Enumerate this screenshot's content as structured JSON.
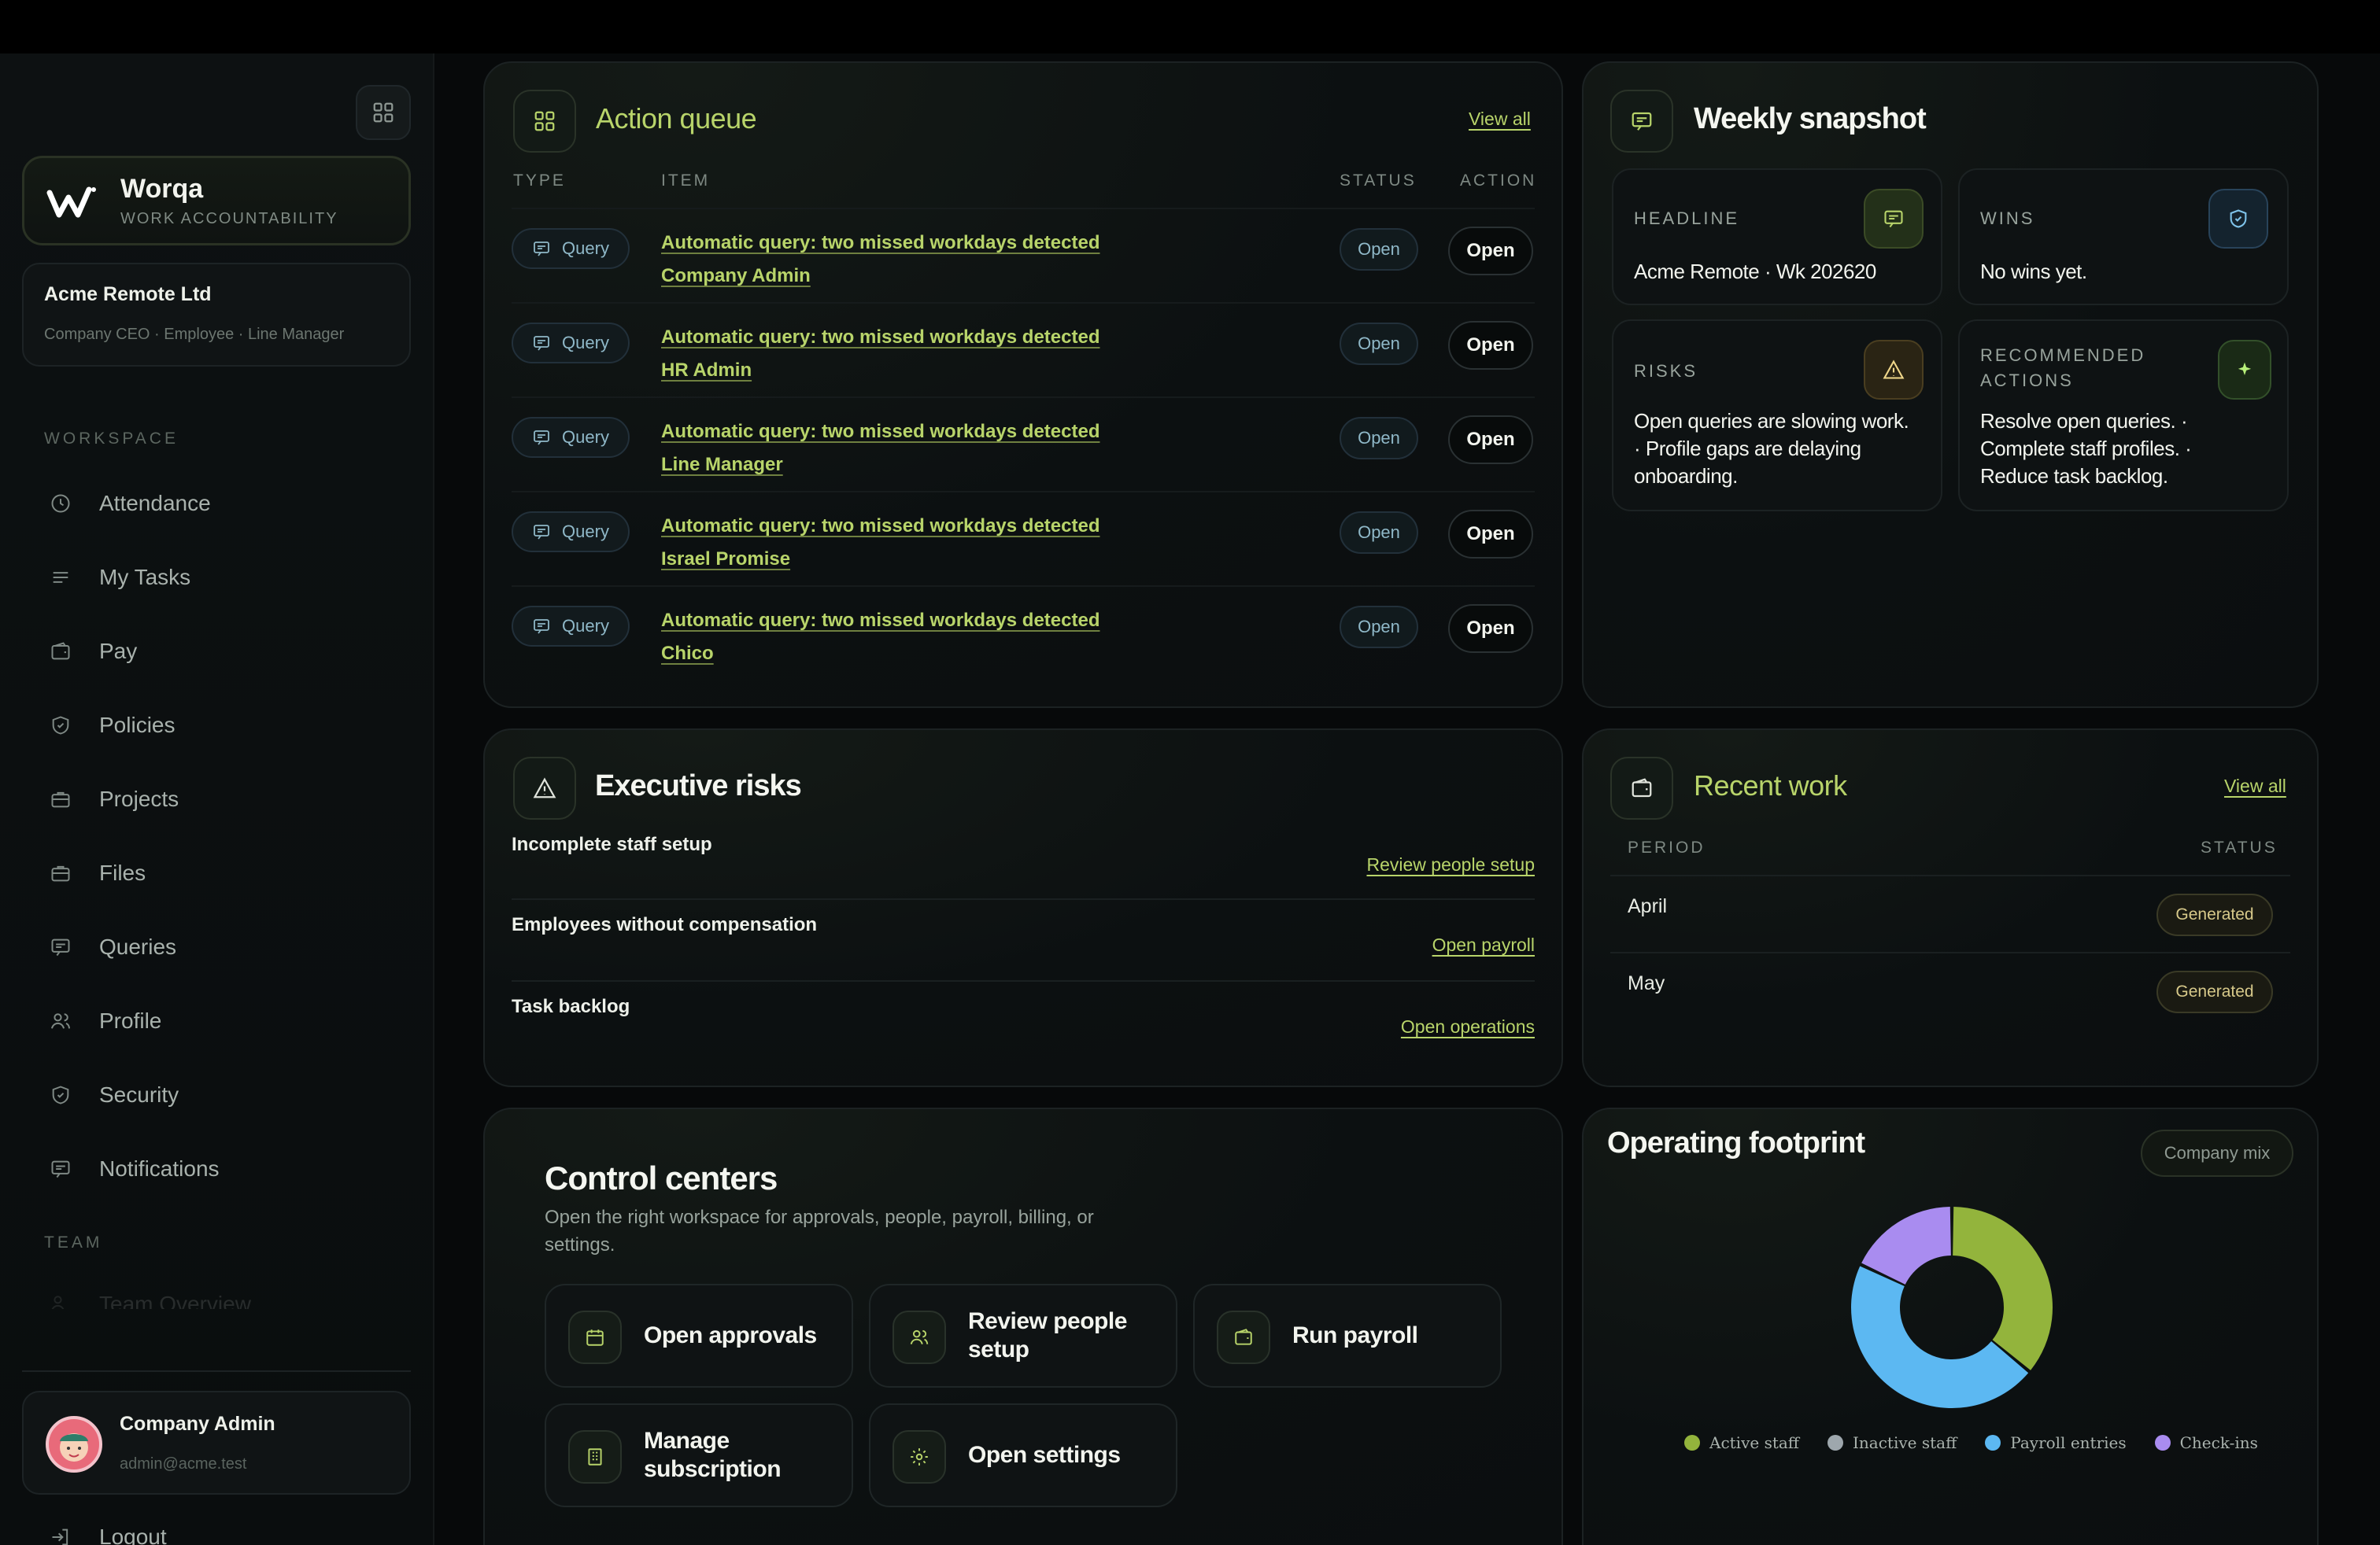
{
  "sidebar": {
    "brand_name": "Worqa",
    "brand_sub": "WORK ACCOUNTABILITY",
    "org_name": "Acme Remote Ltd",
    "org_roles": "Company CEO · Employee · Line Manager",
    "workspace_heading": "WORKSPACE",
    "team_heading": "TEAM",
    "items": [
      {
        "label": "Attendance",
        "icon": "clock-icon"
      },
      {
        "label": "My Tasks",
        "icon": "list-icon"
      },
      {
        "label": "Pay",
        "icon": "wallet-icon"
      },
      {
        "label": "Policies",
        "icon": "shield-icon"
      },
      {
        "label": "Projects",
        "icon": "briefcase-icon"
      },
      {
        "label": "Files",
        "icon": "briefcase-icon"
      },
      {
        "label": "Queries",
        "icon": "chat-icon"
      },
      {
        "label": "Profile",
        "icon": "users-icon"
      },
      {
        "label": "Security",
        "icon": "shield-icon"
      },
      {
        "label": "Notifications",
        "icon": "chat-icon"
      }
    ],
    "team_item": "Team Overview",
    "user_name": "Company Admin",
    "user_email": "admin@acme.test",
    "logout": "Logout"
  },
  "action_queue": {
    "title": "Action queue",
    "view_all": "View all",
    "headers": {
      "type": "TYPE",
      "item": "ITEM",
      "status": "STATUS",
      "action": "ACTION"
    },
    "rows": [
      {
        "type": "Query",
        "line1": "Automatic query: two missed workdays detected",
        "line2": "Company Admin",
        "status": "Open",
        "action": "Open"
      },
      {
        "type": "Query",
        "line1": "Automatic query: two missed workdays detected",
        "line2": "HR Admin",
        "status": "Open",
        "action": "Open"
      },
      {
        "type": "Query",
        "line1": "Automatic query: two missed workdays detected",
        "line2": "Line Manager",
        "status": "Open",
        "action": "Open"
      },
      {
        "type": "Query",
        "line1": "Automatic query: two missed workdays detected",
        "line2": "Israel Promise",
        "status": "Open",
        "action": "Open"
      },
      {
        "type": "Query",
        "line1": "Automatic query: two missed workdays detected",
        "line2": "Chico",
        "status": "Open",
        "action": "Open"
      }
    ]
  },
  "weekly_snapshot": {
    "title": "Weekly snapshot",
    "headline_label": "HEADLINE",
    "headline_text": "Acme Remote · Wk 202620",
    "wins_label": "WINS",
    "wins_text": "No wins yet.",
    "risks_label": "RISKS",
    "risks_lines": [
      "Open queries are slowing work.",
      "· Profile gaps are delaying",
      "onboarding."
    ],
    "rec_label_lines": [
      "RECOMMENDED",
      "ACTIONS"
    ],
    "rec_lines": [
      "Resolve open queries. ·",
      "Complete staff profiles. ·",
      "Reduce task backlog."
    ]
  },
  "exec_risks": {
    "title": "Executive risks",
    "rows": [
      {
        "title": "Incomplete staff setup",
        "link": "Review people setup"
      },
      {
        "title": "Employees without compensation",
        "link": "Open payroll"
      },
      {
        "title": "Task backlog",
        "link": "Open operations"
      }
    ]
  },
  "recent_work": {
    "title": "Recent work",
    "view_all": "View all",
    "headers": {
      "period": "PERIOD",
      "status": "STATUS"
    },
    "rows": [
      {
        "period": "April",
        "status": "Generated"
      },
      {
        "period": "May",
        "status": "Generated"
      }
    ]
  },
  "control_centers": {
    "title": "Control centers",
    "description": "Open the right workspace for approvals, people, payroll, billing, or settings.",
    "buttons": [
      {
        "label": "Open approvals",
        "icon": "calendar-icon"
      },
      {
        "label": "Review people setup",
        "icon": "users-icon"
      },
      {
        "label": "Run payroll",
        "icon": "wallet-icon"
      },
      {
        "label": "Manage subscription",
        "icon": "building-icon"
      },
      {
        "label": "Open settings",
        "icon": "gear-icon"
      }
    ]
  },
  "operating_footprint": {
    "title": "Operating footprint",
    "pill": "Company mix"
  },
  "chart_data": {
    "type": "pie",
    "donut": true,
    "categories": [
      "Active staff",
      "Inactive staff",
      "Payroll entries",
      "Check-ins"
    ],
    "values": [
      36,
      0,
      46,
      18
    ],
    "colors": [
      "#93b43c",
      "#9ea7ad",
      "#5cb8f2",
      "#a98cf0"
    ],
    "legend": "bottom"
  }
}
